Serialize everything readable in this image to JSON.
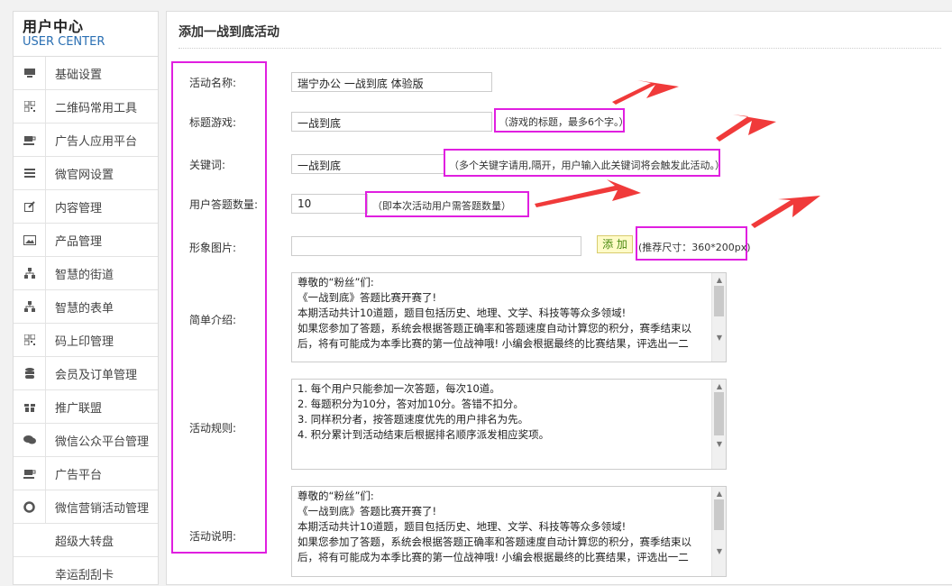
{
  "brand": {
    "title_cn": "用户中心",
    "title_en": "USER CENTER"
  },
  "sidebar": {
    "items": [
      {
        "label": "基础设置",
        "icon": "monitor-icon"
      },
      {
        "label": "二维码常用工具",
        "icon": "qrcode-icon"
      },
      {
        "label": "广告人应用平台",
        "icon": "coffee-icon"
      },
      {
        "label": "微官网设置",
        "icon": "list-icon"
      },
      {
        "label": "内容管理",
        "icon": "edit-icon"
      },
      {
        "label": "产品管理",
        "icon": "image-icon"
      },
      {
        "label": "智慧的街道",
        "icon": "sitemap-icon"
      },
      {
        "label": "智慧的表单",
        "icon": "sitemap-icon"
      },
      {
        "label": "码上印管理",
        "icon": "qrcode-icon"
      },
      {
        "label": "会员及订单管理",
        "icon": "database-icon"
      },
      {
        "label": "推广联盟",
        "icon": "gift-icon"
      },
      {
        "label": "微信公众平台管理",
        "icon": "chat-icon"
      },
      {
        "label": "广告平台",
        "icon": "coffee-icon"
      },
      {
        "label": "微信营销活动管理",
        "icon": "lifebuoy-icon"
      }
    ],
    "subitems": [
      {
        "label": "超级大转盘"
      },
      {
        "label": "幸运刮刮卡"
      }
    ]
  },
  "main": {
    "title": "添加一战到底活动",
    "fields": {
      "activity_name": {
        "label": "活动名称:",
        "value": "瑞宁办公 一战到底 体验版"
      },
      "game_title": {
        "label": "标题游戏:",
        "value": "一战到底",
        "hint": "（游戏的标题，最多6个字。）"
      },
      "keywords": {
        "label": "关键词:",
        "value": "一战到底",
        "hint": "（多个关键字请用,隔开，用户输入此关键词将会触发此活动。）"
      },
      "question_count": {
        "label": "用户答题数量:",
        "value": "10",
        "hint": "（即本次活动用户需答题数量）"
      },
      "image": {
        "label": "形象图片:",
        "value": "",
        "button": "添 加",
        "hint": "(推荐尺寸：360*200px)"
      },
      "intro": {
        "label": "简单介绍:",
        "lines": [
          "尊敬的“粉丝”们:",
          "《一战到底》答题比赛开赛了!",
          "本期活动共计10道题，题目包括历史、地理、文学、科技等等众多领域!",
          "如果您参加了答题，系统会根据答题正确率和答题速度自动计算您的积分，赛季结束以",
          "后，将有可能成为本季比赛的第一位战神哦! 小编会根据最终的比赛结果，评选出一二"
        ]
      },
      "rules": {
        "label": "活动规则:",
        "lines": [
          "1. 每个用户只能参加一次答题，每次10道。",
          "2. 每题积分为10分，答对加10分。答错不扣分。",
          "3. 同样积分者，按答题速度优先的用户排名为先。",
          "4. 积分累计到活动结束后根据排名顺序派发相应奖项。"
        ]
      },
      "description": {
        "label": "活动说明:",
        "lines": [
          "尊敬的“粉丝”们:",
          "《一战到底》答题比赛开赛了!",
          "本期活动共计10道题，题目包括历史、地理、文学、科技等等众多领域!",
          "如果您参加了答题，系统会根据答题正确率和答题速度自动计算您的积分，赛季结束以",
          "后，将有可能成为本季比赛的第一位战神哦! 小编会根据最终的比赛结果，评选出一二"
        ]
      }
    }
  },
  "colors": {
    "highlight_border": "#e01fe0",
    "arrow": "#f03a3a",
    "brand_en": "#2a6fb3",
    "add_button_bg": "#fffbc8"
  }
}
